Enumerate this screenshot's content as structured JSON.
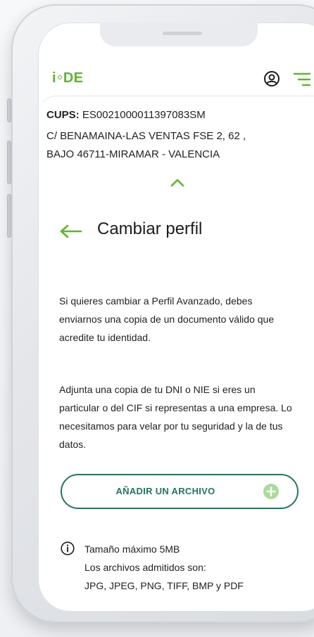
{
  "app": {
    "logo_text": "i·DE",
    "logo_prefix": "i",
    "logo_suffix": "DE",
    "brand_color": "#5bb82a",
    "accent_color": "#1f7a5c",
    "icons": {
      "user": "user-circle-icon",
      "menu": "menu-icon",
      "chevron": "chevron-up-icon",
      "back": "arrow-left-icon",
      "add": "plus-circle-icon",
      "info": "info-icon"
    }
  },
  "supply": {
    "cups_label": "CUPS:",
    "cups_value": "ES0021000011397083SM",
    "address_line1": "C/ BENAMAINA-LAS VENTAS FSE 2, 62 ,",
    "address_line2": "BAJO 46711-MIRAMAR - VALENCIA"
  },
  "page": {
    "title": "Cambiar perfil",
    "paragraph1": "Si quieres cambiar a Perfil Avanzado, debes enviarnos una copia de un documento válido que acredite tu identidad.",
    "paragraph2": "Adjunta una copia de tu DNI o NIE si eres un particular o del CIF si representas a una empresa. Lo necesitamos para velar por tu seguridad y la de tus datos."
  },
  "upload": {
    "button_label": "AÑADIR UN ARCHIVO"
  },
  "info": {
    "max_size": "Tamaño máximo 5MB",
    "allowed_label": "Los archivos admitidos son:",
    "allowed_types": "JPG, JPEG, PNG, TIFF, BMP y PDF"
  }
}
